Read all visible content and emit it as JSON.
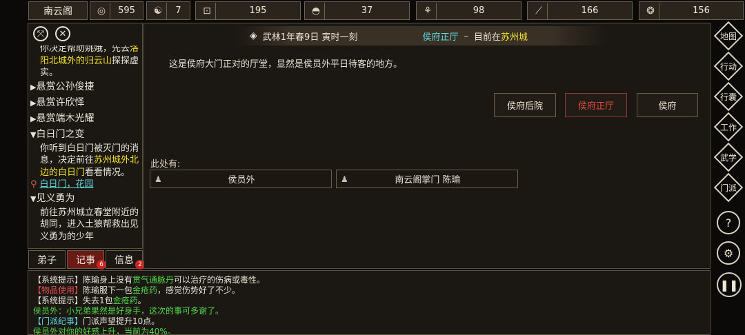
{
  "top_bar": {
    "sect_name": "南云阁",
    "stats": [
      {
        "icon": "coin-icon",
        "glyph": "◎",
        "value": "595"
      },
      {
        "icon": "yin-yang-icon",
        "glyph": "☯",
        "value": "7"
      },
      {
        "icon": "copper-coin-icon",
        "glyph": "⊡",
        "value": "195"
      },
      {
        "icon": "food-bowl-icon",
        "glyph": "◓",
        "value": "37"
      },
      {
        "icon": "herb-icon",
        "glyph": "⚘",
        "value": "98"
      },
      {
        "icon": "wood-icon",
        "glyph": "⟋",
        "value": "166"
      },
      {
        "icon": "ore-icon",
        "glyph": "❂",
        "value": "156"
      }
    ]
  },
  "left_panel": {
    "quests": [
      {
        "kind": "text",
        "parts": [
          {
            "t": "你决定帮助姚娥，先去"
          },
          {
            "t": "洛阳北城外的归云山",
            "hl": true
          },
          {
            "t": "探探虚实。"
          }
        ]
      },
      {
        "kind": "collapsed",
        "title": "悬赏公孙俊捷"
      },
      {
        "kind": "collapsed",
        "title": "悬赏许欣怿"
      },
      {
        "kind": "collapsed",
        "title": "悬赏端木光耀"
      },
      {
        "kind": "expanded",
        "title": "白日门之变"
      },
      {
        "kind": "text",
        "parts": [
          {
            "t": "你听到白日门被灭门的消息，决定前往"
          },
          {
            "t": "苏州城外北边的白日门",
            "hl": true
          },
          {
            "t": "看看情况。"
          }
        ]
      },
      {
        "kind": "location",
        "text": "白日门，花园"
      },
      {
        "kind": "expanded",
        "title": "见义勇为"
      },
      {
        "kind": "text",
        "parts": [
          {
            "t": "前往苏州城立春堂附近的胡同，进入土狼帮救出见义勇为的少年"
          }
        ]
      }
    ],
    "tabs": [
      {
        "label": "弟子",
        "badge": ""
      },
      {
        "label": "记事",
        "badge": "6"
      },
      {
        "label": "信息",
        "badge": "2"
      }
    ]
  },
  "main": {
    "header": {
      "date": "武林1年春9日 寅时一刻",
      "location": "侯府正厅",
      "sep": "–",
      "current_prefix": "目前在",
      "city": "苏州城"
    },
    "description": "这是侯府大门正对的厅堂，显然是侯员外平日待客的地方。",
    "nav": [
      {
        "label": "侯府后院",
        "current": false
      },
      {
        "label": "侯府正厅",
        "current": true
      },
      {
        "label": "侯府",
        "current": false
      }
    ],
    "here_label": "此处有:",
    "npcs": [
      "侯员外",
      "南云阁掌门 陈瑜"
    ]
  },
  "log": [
    {
      "parts": [
        {
          "t": "【系统提示】陈瑜身上没有"
        },
        {
          "t": "贯气通脉丹",
          "c": "grn"
        },
        {
          "t": "可以治疗的伤病或毒性。"
        }
      ]
    },
    {
      "parts": [
        {
          "t": "【物品使用】",
          "c": "red"
        },
        {
          "t": "陈瑜服下一包"
        },
        {
          "t": "金疮药",
          "c": "grn"
        },
        {
          "t": "，感觉伤势好了不少。"
        }
      ]
    },
    {
      "parts": [
        {
          "t": "【系统提示】失去1包"
        },
        {
          "t": "金疮药",
          "c": "grn"
        },
        {
          "t": "。"
        }
      ]
    },
    {
      "parts": [
        {
          "t": "侯员外：小兄弟果然是好身手，这次的事可多谢了。",
          "c": "grn"
        }
      ]
    },
    {
      "parts": [
        {
          "t": "【门派纪事】",
          "c": "lc"
        },
        {
          "t": "门派声望提升10点。"
        }
      ]
    },
    {
      "parts": [
        {
          "t": "侯员外对你的好感上升，当前为40%。",
          "c": "grn"
        }
      ]
    }
  ],
  "right_menu": [
    {
      "name": "map-button",
      "label": "地图"
    },
    {
      "name": "action-button",
      "label": "行动"
    },
    {
      "name": "inventory-button",
      "label": "行囊"
    },
    {
      "name": "work-button",
      "label": "工作"
    },
    {
      "name": "martial-button",
      "label": "武学"
    },
    {
      "name": "sect-button",
      "label": "门派"
    }
  ]
}
